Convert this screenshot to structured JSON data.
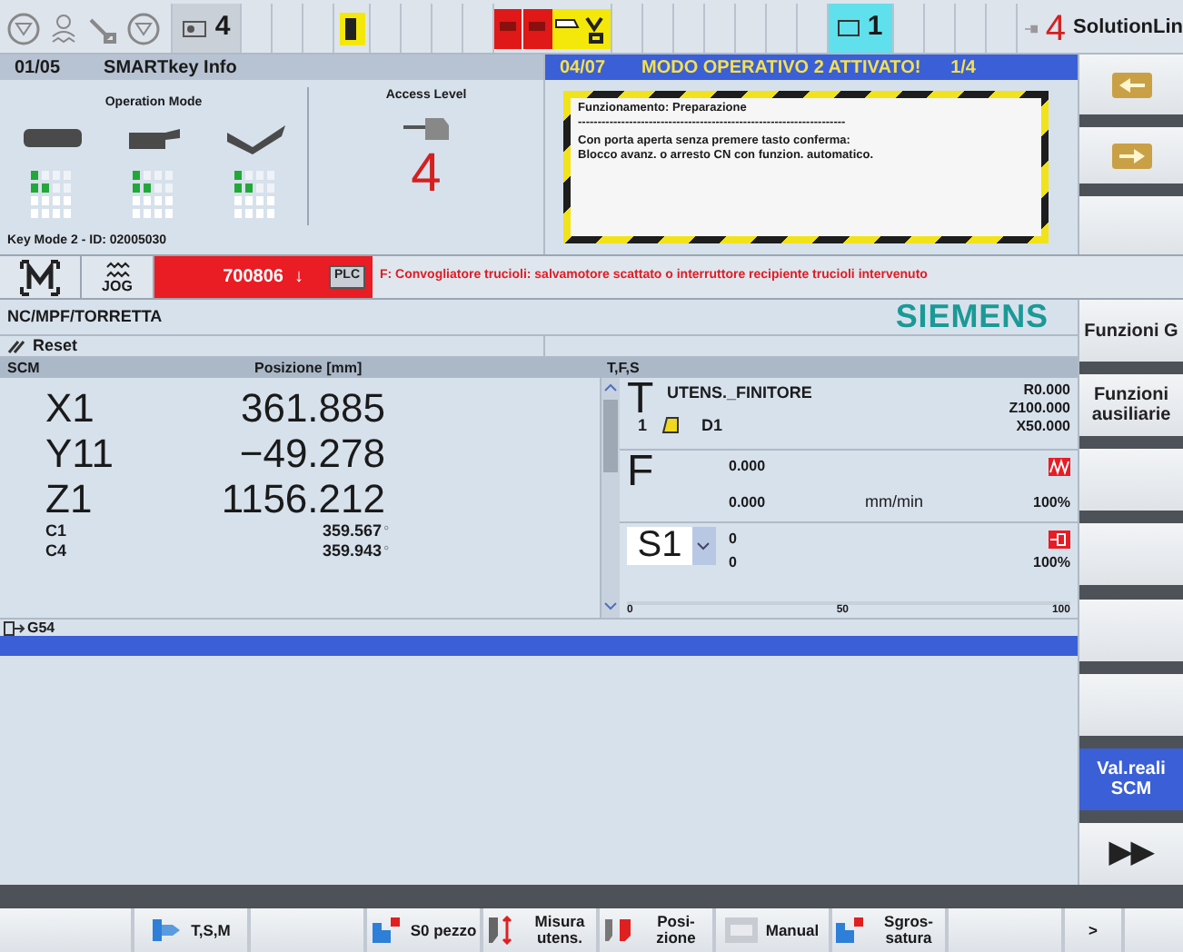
{
  "status_bar": {
    "key_count": "4",
    "channel_count": "1",
    "access_level": "4",
    "product": "SolutionLin"
  },
  "smartkey_panel": {
    "page": "01/05",
    "title": "SMARTkey Info",
    "operation_mode_label": "Operation Mode",
    "access_level_label": "Access Level",
    "access_level": "4",
    "key_info": "Key Mode 2 - ID: 02005030"
  },
  "message_panel": {
    "page": "04/07",
    "title": "MODO OPERATIVO 2 ATTIVATO!",
    "counter": "1/4",
    "lines": [
      "Funzionamento: Preparazione",
      "--------------------------------------------------------------------",
      "Con porta aperta senza premere tasto conferma:",
      "Blocco avanz. o arresto CN con funzion. automatico."
    ]
  },
  "channel_bar": {
    "mode": "JOG",
    "alarm_number": "700806",
    "alarm_arrow": "↓",
    "alarm_source": "PLC",
    "alarm_text": "F: Convogliatore trucioli: salvamotore scattato o interruttore recipiente trucioli intervenuto"
  },
  "program": {
    "path": "NC/MPF/TORRETTA",
    "logo": "SIEMENS",
    "status": "Reset"
  },
  "axes": {
    "columns": [
      "SCM",
      "Posizione [mm]"
    ],
    "rows": [
      {
        "kind": "large",
        "axis": "X1",
        "value": "361.885"
      },
      {
        "kind": "large",
        "axis": "Y11",
        "value": "−49.278"
      },
      {
        "kind": "large",
        "axis": "Z1",
        "value": "1156.212"
      },
      {
        "kind": "small",
        "axis": "C1",
        "value": "359.567",
        "unit": "°"
      },
      {
        "kind": "small",
        "axis": "C4",
        "value": "359.943",
        "unit": "°"
      }
    ],
    "frame": "G54"
  },
  "tfs": {
    "title": "T,F,S",
    "tool": {
      "letter": "T",
      "name": "UTENS._FINITORE",
      "number": "1",
      "edge": "D1",
      "offsets": [
        "R0.000",
        "Z100.000",
        "X50.000"
      ]
    },
    "feed": {
      "letter": "F",
      "actual": "0.000",
      "set": "0.000",
      "unit": "mm/min",
      "override": "100%"
    },
    "spindle": {
      "name": "S1",
      "actual": "0",
      "set": "0",
      "override": "100%",
      "scale": [
        "0",
        "50",
        "100"
      ]
    }
  },
  "vertical_softkeys": [
    {
      "label": "Funzioni G",
      "selected": false
    },
    {
      "label": "Funzioni ausiliarie",
      "selected": false
    },
    {
      "selected": false
    },
    {
      "selected": false
    },
    {
      "selected": false
    },
    {
      "selected": false
    },
    {
      "label": "Val.reali SCM",
      "selected": true
    },
    {
      "label": "▶▶",
      "selected": false
    }
  ],
  "horizontal_softkeys": [
    {
      "kind": "plain"
    },
    {
      "label": "T,S,M",
      "kind": "tool"
    },
    {
      "kind": "plain"
    },
    {
      "label": "S0 pezzo",
      "kind": "part"
    },
    {
      "label": "Misura utens.",
      "kind": "measure"
    },
    {
      "label": "Posi- zione",
      "kind": "position"
    },
    {
      "label": "Manual",
      "kind": "dmg"
    },
    {
      "label": "Sgros- satura",
      "kind": "part"
    },
    {
      "kind": "plain"
    },
    {
      "label": ">",
      "kind": "plain"
    },
    {
      "kind": "plain"
    }
  ]
}
